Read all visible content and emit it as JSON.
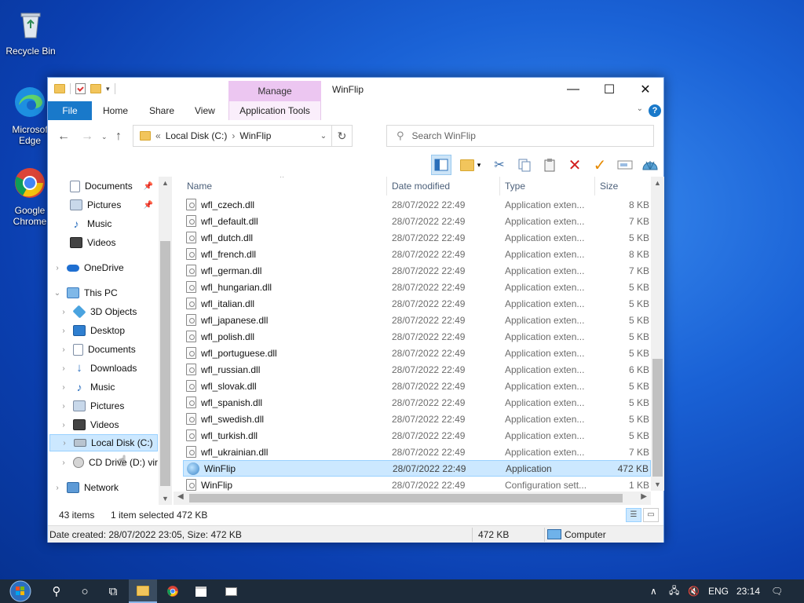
{
  "desktop": {
    "icons": [
      {
        "label": "Recycle Bin",
        "icon": "recycle-bin-icon"
      },
      {
        "label": "Microsoft Edge",
        "line1": "Microsof",
        "line2": "Edge",
        "icon": "edge-icon"
      },
      {
        "label": "Google Chrome",
        "line1": "Google",
        "line2": "Chrome",
        "icon": "chrome-icon"
      }
    ]
  },
  "window": {
    "title": "WinFlip",
    "contextual_tab_group": "Manage",
    "tabs": {
      "file": "File",
      "home": "Home",
      "share": "Share",
      "view": "View",
      "app_tools": "Application Tools"
    },
    "controls": {
      "minimize": "—",
      "maximize": "☐",
      "close": "✕"
    },
    "help": "?"
  },
  "address": {
    "prefix": "«",
    "crumbs": [
      "Local Disk (C:)",
      "WinFlip"
    ],
    "separator": "›"
  },
  "search": {
    "placeholder": "Search WinFlip"
  },
  "nav": {
    "items": [
      {
        "label": "Documents",
        "icon": "documents-icon",
        "pinned": true
      },
      {
        "label": "Pictures",
        "icon": "pictures-icon",
        "pinned": true
      },
      {
        "label": "Music",
        "icon": "music-icon"
      },
      {
        "label": "Videos",
        "icon": "videos-icon"
      },
      {
        "label": "OneDrive",
        "icon": "onedrive-icon"
      },
      {
        "label": "This PC",
        "icon": "this-pc-icon"
      },
      {
        "label": "3D Objects",
        "icon": "3d-objects-icon"
      },
      {
        "label": "Desktop",
        "icon": "desktop-icon"
      },
      {
        "label": "Documents",
        "icon": "documents-icon"
      },
      {
        "label": "Downloads",
        "icon": "downloads-icon"
      },
      {
        "label": "Music",
        "icon": "music-icon"
      },
      {
        "label": "Pictures",
        "icon": "pictures-icon"
      },
      {
        "label": "Videos",
        "icon": "videos-icon"
      },
      {
        "label": "Local Disk (C:)",
        "icon": "local-disk-icon",
        "selected": true
      },
      {
        "label": "CD Drive (D:) vir",
        "icon": "cd-drive-icon"
      },
      {
        "label": "Network",
        "icon": "network-icon"
      }
    ]
  },
  "columns": {
    "name": "Name",
    "date": "Date modified",
    "type": "Type",
    "size": "Size"
  },
  "files": [
    {
      "name": "wfl_czech.dll",
      "date": "28/07/2022 22:49",
      "type": "Application exten...",
      "size": "8 KB"
    },
    {
      "name": "wfl_default.dll",
      "date": "28/07/2022 22:49",
      "type": "Application exten...",
      "size": "7 KB"
    },
    {
      "name": "wfl_dutch.dll",
      "date": "28/07/2022 22:49",
      "type": "Application exten...",
      "size": "5 KB"
    },
    {
      "name": "wfl_french.dll",
      "date": "28/07/2022 22:49",
      "type": "Application exten...",
      "size": "8 KB"
    },
    {
      "name": "wfl_german.dll",
      "date": "28/07/2022 22:49",
      "type": "Application exten...",
      "size": "7 KB"
    },
    {
      "name": "wfl_hungarian.dll",
      "date": "28/07/2022 22:49",
      "type": "Application exten...",
      "size": "5 KB"
    },
    {
      "name": "wfl_italian.dll",
      "date": "28/07/2022 22:49",
      "type": "Application exten...",
      "size": "5 KB"
    },
    {
      "name": "wfl_japanese.dll",
      "date": "28/07/2022 22:49",
      "type": "Application exten...",
      "size": "5 KB"
    },
    {
      "name": "wfl_polish.dll",
      "date": "28/07/2022 22:49",
      "type": "Application exten...",
      "size": "5 KB"
    },
    {
      "name": "wfl_portuguese.dll",
      "date": "28/07/2022 22:49",
      "type": "Application exten...",
      "size": "5 KB"
    },
    {
      "name": "wfl_russian.dll",
      "date": "28/07/2022 22:49",
      "type": "Application exten...",
      "size": "6 KB"
    },
    {
      "name": "wfl_slovak.dll",
      "date": "28/07/2022 22:49",
      "type": "Application exten...",
      "size": "5 KB"
    },
    {
      "name": "wfl_spanish.dll",
      "date": "28/07/2022 22:49",
      "type": "Application exten...",
      "size": "5 KB"
    },
    {
      "name": "wfl_swedish.dll",
      "date": "28/07/2022 22:49",
      "type": "Application exten...",
      "size": "5 KB"
    },
    {
      "name": "wfl_turkish.dll",
      "date": "28/07/2022 22:49",
      "type": "Application exten...",
      "size": "5 KB"
    },
    {
      "name": "wfl_ukrainian.dll",
      "date": "28/07/2022 22:49",
      "type": "Application exten...",
      "size": "7 KB"
    },
    {
      "name": "WinFlip",
      "date": "28/07/2022 22:49",
      "type": "Application",
      "size": "472 KB",
      "selected": true,
      "kind": "app"
    },
    {
      "name": "WinFlip",
      "date": "28/07/2022 22:49",
      "type": "Configuration sett...",
      "size": "1 KB",
      "kind": "config"
    }
  ],
  "status": {
    "count": "43 items",
    "selection": "1 item selected",
    "size": "472 KB"
  },
  "details": {
    "created": "Date created: 28/07/2022 23:05, Size: 472 KB",
    "size": "472 KB",
    "location": "Computer"
  },
  "taskbar": {
    "language": "ENG",
    "time": "23:14"
  },
  "colors": {
    "accent": "#1979ca",
    "selection": "#cce8ff",
    "manage_tab": "#ecc6f1",
    "taskbar": "#1d2b3a"
  }
}
